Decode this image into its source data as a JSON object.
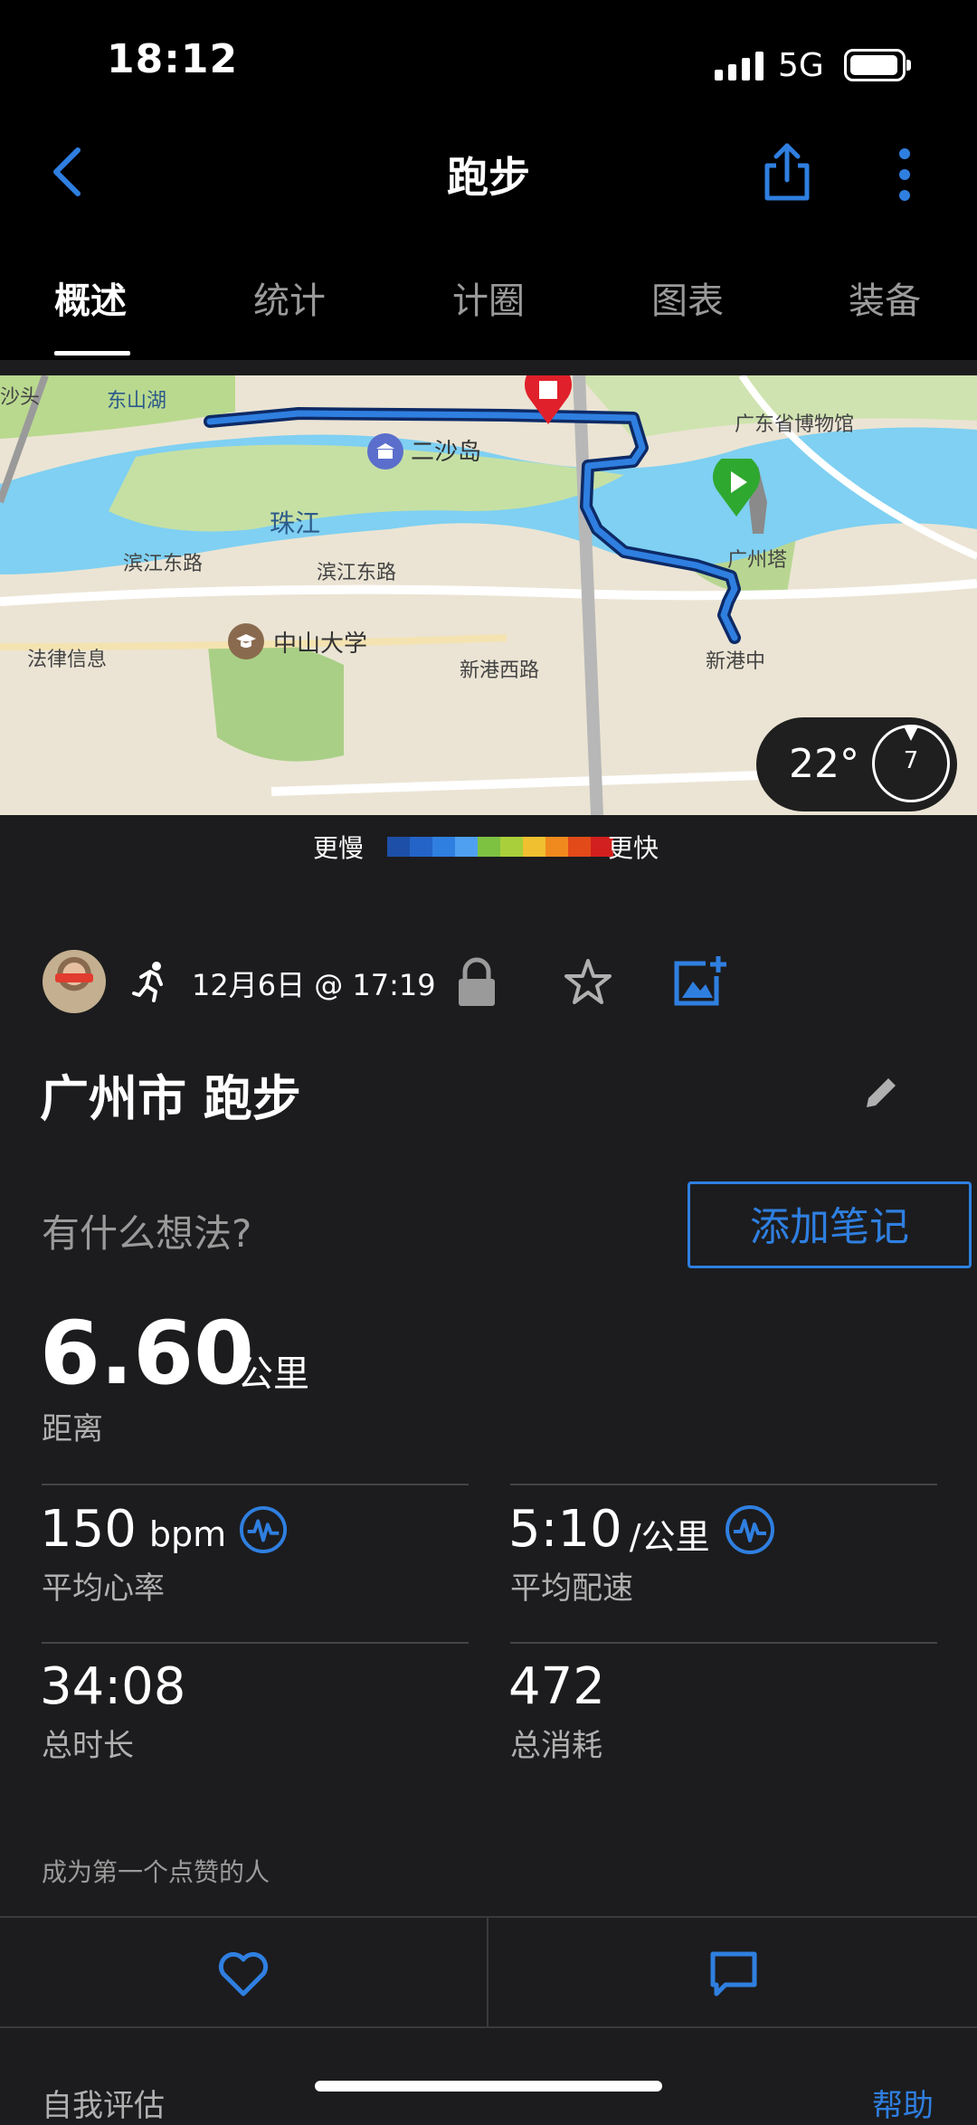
{
  "status_bar": {
    "time": "18:12",
    "network": "5G"
  },
  "header": {
    "title": "跑步"
  },
  "tabs": [
    {
      "label": "概述",
      "active": true
    },
    {
      "label": "统计",
      "active": false
    },
    {
      "label": "计圈",
      "active": false
    },
    {
      "label": "图表",
      "active": false
    },
    {
      "label": "装备",
      "active": false
    }
  ],
  "map": {
    "labels": {
      "dongshanhu": "东山湖",
      "shatou": "沙头",
      "museum": "广东省博物馆",
      "ershadao": "二沙岛",
      "zhujiang": "珠江",
      "binjiang1": "滨江东路",
      "binjiang2": "滨江东路",
      "guangzhouta": "广州塔",
      "zhongshan": "中山大学",
      "xingang": "新港西路",
      "xingang2": "新港中",
      "legal": "法律信息"
    },
    "weather": {
      "temp": "22°",
      "wind": "7"
    }
  },
  "legend": {
    "slow": "更慢",
    "fast": "更快",
    "colors": [
      "#1d4fa8",
      "#2464c8",
      "#2f7fe0",
      "#4fa0f0",
      "#7ec242",
      "#a9cf3a",
      "#f0c030",
      "#f08a1e",
      "#e24a1a",
      "#d21f1f"
    ]
  },
  "activity": {
    "date": "12月6日 @ 17:19",
    "title": "广州市 跑步",
    "notes_prompt": "有什么想法?",
    "add_note": "添加笔记",
    "distance": {
      "value": "6.60",
      "unit": "公里",
      "label": "距离"
    },
    "stats": [
      {
        "value": "150",
        "unit": "bpm",
        "label": "平均心率"
      },
      {
        "value": "5:10",
        "unit": "/公里",
        "label": "平均配速"
      },
      {
        "value": "34:08",
        "unit": "",
        "label": "总时长"
      },
      {
        "value": "472",
        "unit": "",
        "label": "总消耗"
      }
    ],
    "likes_text": "成为第一个点赞的人"
  },
  "footer": {
    "self_eval": "自我评估",
    "help": "帮助"
  }
}
